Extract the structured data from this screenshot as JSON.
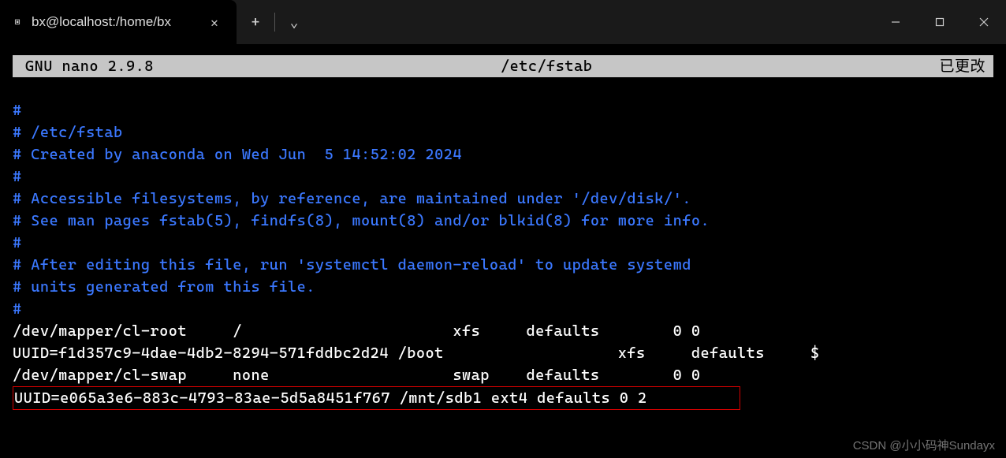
{
  "titlebar": {
    "tab_title": "bx@localhost:/home/bx",
    "icon_glyph": "▣",
    "close_glyph": "✕",
    "new_tab_glyph": "+",
    "dropdown_glyph": "⌄",
    "min_aria": "minimize",
    "max_aria": "maximize",
    "close_aria": "close"
  },
  "nano": {
    "left": " GNU nano 2.9.8",
    "center": "/etc/fstab",
    "right": "已更改 "
  },
  "content": {
    "lines": [
      "#",
      "# /etc/fstab",
      "# Created by anaconda on Wed Jun  5 14:52:02 2024",
      "#",
      "# Accessible filesystems, by reference, are maintained under '/dev/disk/'.",
      "# See man pages fstab(5), findfs(8), mount(8) and/or blkid(8) for more info.",
      "#",
      "# After editing this file, run 'systemctl daemon-reload' to update systemd",
      "# units generated from this file.",
      "#"
    ],
    "entries": [
      "/dev/mapper/cl-root     /                       xfs     defaults        0 0",
      "UUID=f1d357c9-4dae-4db2-8294-571fddbc2d24 /boot                   xfs     defaults     $",
      "/dev/mapper/cl-swap     none                    swap    defaults        0 0"
    ],
    "highlighted": "UUID=e065a3e6-883c-4793-83ae-5d5a8451f767 /mnt/sdb1 ext4 defaults 0 2          "
  },
  "watermark": "CSDN @小小码神Sundayx"
}
